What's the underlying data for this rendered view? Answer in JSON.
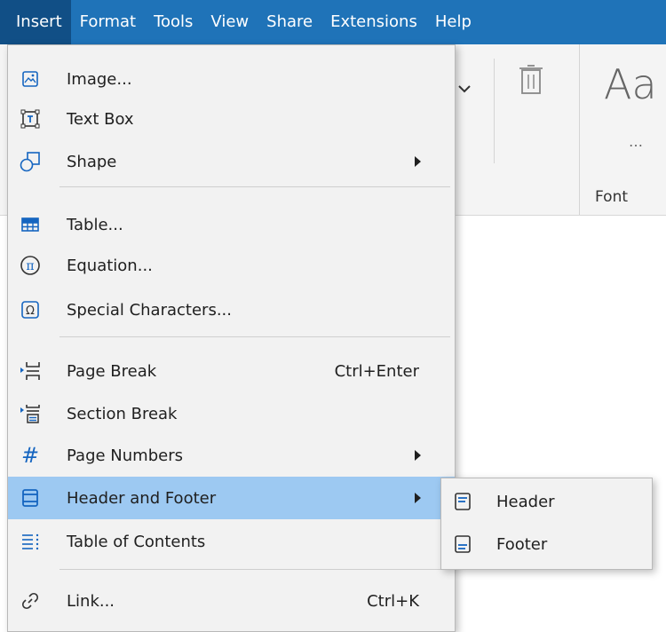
{
  "menubar": {
    "items": [
      "Insert",
      "Format",
      "Tools",
      "View",
      "Share",
      "Extensions",
      "Help"
    ],
    "active": "Insert"
  },
  "ribbon": {
    "font_sample": "Aa",
    "more": "…",
    "font_group_label": "Font"
  },
  "insert_menu": {
    "items": [
      {
        "label": "Image...",
        "icon": "image-icon"
      },
      {
        "label": "Text Box",
        "icon": "text-box-icon"
      },
      {
        "label": "Shape",
        "icon": "shape-icon",
        "submenu": true
      },
      {
        "label": "Table...",
        "icon": "table-icon"
      },
      {
        "label": "Equation...",
        "icon": "equation-icon"
      },
      {
        "label": "Special Characters...",
        "icon": "special-characters-icon"
      },
      {
        "label": "Page Break",
        "icon": "page-break-icon",
        "shortcut": "Ctrl+Enter"
      },
      {
        "label": "Section Break",
        "icon": "section-break-icon"
      },
      {
        "label": "Page Numbers",
        "icon": "page-numbers-icon",
        "symbol": "#",
        "submenu": true
      },
      {
        "label": "Header and Footer",
        "icon": "header-footer-icon",
        "submenu": true,
        "highlighted": true
      },
      {
        "label": "Table of Contents",
        "icon": "table-of-contents-icon"
      },
      {
        "label": "Link...",
        "icon": "link-icon",
        "shortcut": "Ctrl+K"
      }
    ]
  },
  "submenu": {
    "items": [
      {
        "label": "Header",
        "icon": "header-icon"
      },
      {
        "label": "Footer",
        "icon": "footer-icon"
      }
    ]
  },
  "colors": {
    "menubar_bg": "#1f73b8",
    "menubar_active_bg": "#114f86",
    "highlight_bg": "#9dc9f2",
    "menu_bg": "#f2f2f2",
    "icon_blue": "#1565c0"
  }
}
